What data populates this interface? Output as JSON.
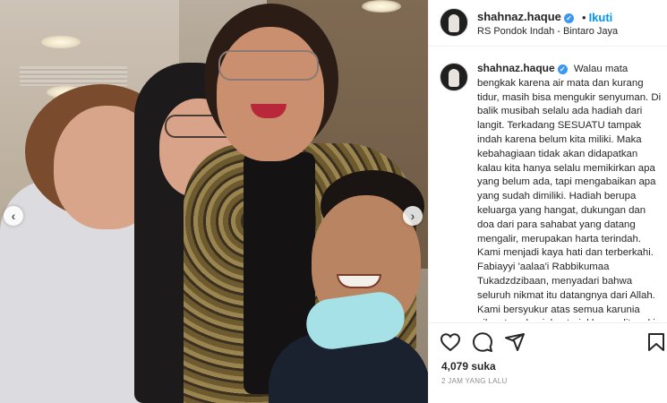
{
  "post": {
    "username": "shahnaz.haque",
    "follow_label": "Ikuti",
    "separator": "•",
    "location": "RS Pondok Indah - Bintaro Jaya"
  },
  "caption": {
    "username": "shahnaz.haque",
    "text": "Walau mata bengkak karena air mata dan kurang tidur, masih bisa mengukir senyuman. Di balik musibah selalu ada hadiah dari langit. Terkadang SESUATU tampak indah karena belum kita miliki. Maka kebahagiaan tidak akan didapatkan kalau kita hanya selalu memikirkan apa yang belum ada, tapi mengabaikan apa yang sudah dimiliki. Hadiah berupa keluarga yang hangat, dukungan dan doa dari para sahabat yang datang mengalir, merupakan harta terindah. Kami menjadi kaya hati dan terberkahi. Fabiayyi 'aalaa'i Rabbikumaa Tukadzdzibaan, menyadari bahwa seluruh nikmat itu datangnya dari Allah. Kami bersyukur atas semua karunia nikmat, walau jalan terjal harus ditapaki."
  },
  "stats": {
    "likes": "4,079 suka",
    "timestamp": "2 JAM YANG LALU"
  },
  "icons": {
    "like": "heart-icon",
    "comment": "comment-icon",
    "share": "share-icon",
    "save": "bookmark-icon",
    "verified": "verified-badge-icon",
    "prev": "chevron-left-icon",
    "next": "chevron-right-icon"
  },
  "colors": {
    "follow": "#0095f6",
    "verified": "#3897f0",
    "mask": "#a6e1e8"
  }
}
